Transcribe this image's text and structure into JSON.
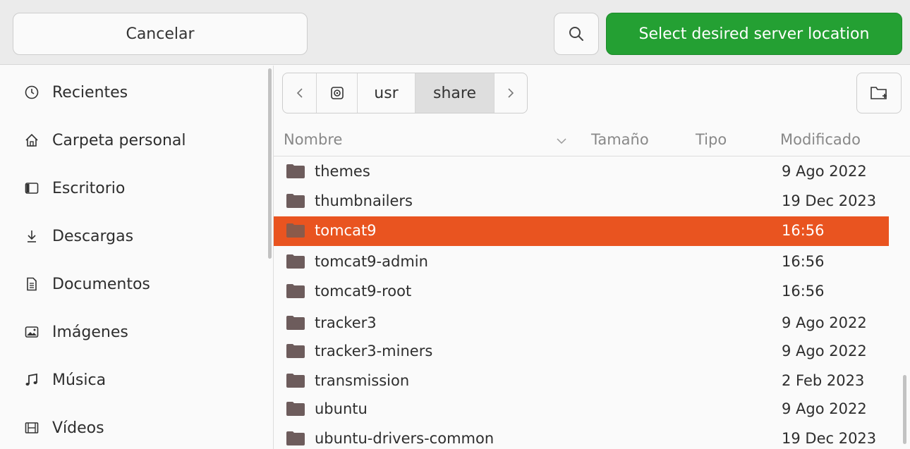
{
  "header": {
    "cancel_label": "Cancelar",
    "select_label": "Select desired server location",
    "accent_color": "#24a033"
  },
  "sidebar": {
    "items": [
      {
        "label": "Recientes",
        "icon": "clock-icon"
      },
      {
        "label": "Carpeta personal",
        "icon": "home-icon"
      },
      {
        "label": "Escritorio",
        "icon": "desktop-icon"
      },
      {
        "label": "Descargas",
        "icon": "download-icon"
      },
      {
        "label": "Documentos",
        "icon": "document-icon"
      },
      {
        "label": "Imágenes",
        "icon": "image-icon"
      },
      {
        "label": "Música",
        "icon": "music-icon"
      },
      {
        "label": "Vídeos",
        "icon": "video-icon"
      }
    ]
  },
  "pathbar": {
    "segments": [
      "usr",
      "share"
    ],
    "active": "share"
  },
  "columns": {
    "name": "Nombre",
    "size": "Tamaño",
    "type": "Tipo",
    "modified": "Modificado"
  },
  "files": [
    {
      "name": "themes",
      "modified": "9 Ago 2022"
    },
    {
      "name": "thumbnailers",
      "modified": "19 Dec 2023"
    },
    {
      "name": "tomcat9",
      "modified": "16:56",
      "selected": true
    },
    {
      "name": "tomcat9-admin",
      "modified": "16:56"
    },
    {
      "name": "tomcat9-root",
      "modified": "16:56"
    },
    {
      "name": "tracker3",
      "modified": "9 Ago 2022"
    },
    {
      "name": "tracker3-miners",
      "modified": "9 Ago 2022"
    },
    {
      "name": "transmission",
      "modified": "2 Feb 2023"
    },
    {
      "name": "ubuntu",
      "modified": "9 Ago 2022"
    },
    {
      "name": "ubuntu-drivers-common",
      "modified": "19 Dec 2023"
    }
  ],
  "selection_color": "#e95420"
}
